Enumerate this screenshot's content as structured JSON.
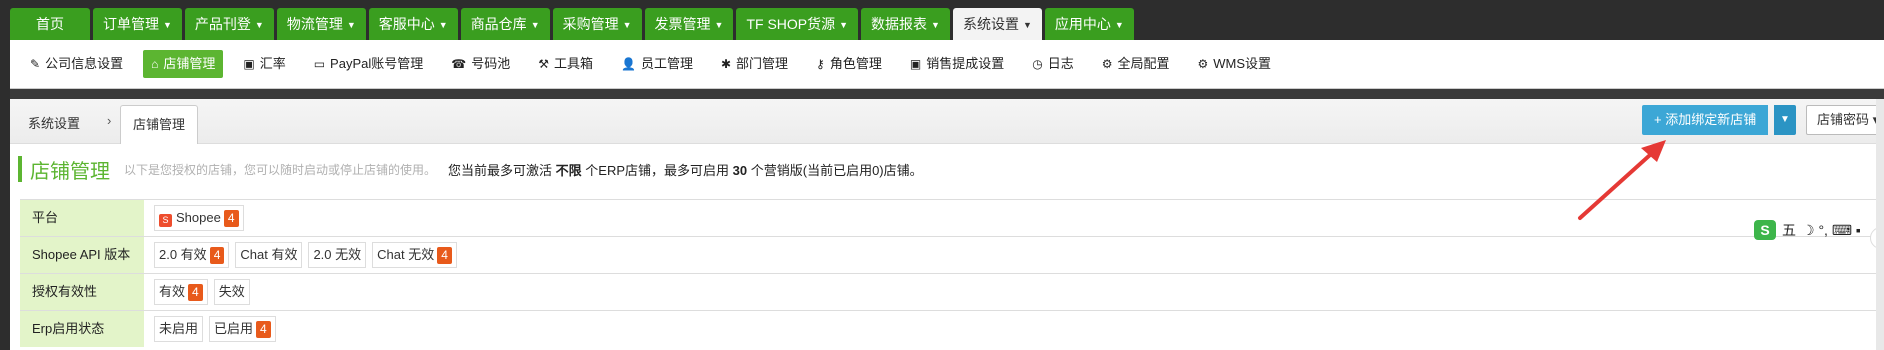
{
  "topnav": [
    {
      "label": "首页",
      "caret": false,
      "active": false
    },
    {
      "label": "订单管理",
      "caret": true,
      "active": false
    },
    {
      "label": "产品刊登",
      "caret": true,
      "active": false
    },
    {
      "label": "物流管理",
      "caret": true,
      "active": false
    },
    {
      "label": "客服中心",
      "caret": true,
      "active": false
    },
    {
      "label": "商品仓库",
      "caret": true,
      "active": false
    },
    {
      "label": "采购管理",
      "caret": true,
      "active": false
    },
    {
      "label": "发票管理",
      "caret": true,
      "active": false
    },
    {
      "label": "TF SHOP货源",
      "caret": true,
      "active": false
    },
    {
      "label": "数据报表",
      "caret": true,
      "active": false
    },
    {
      "label": "系统设置",
      "caret": true,
      "active": true
    },
    {
      "label": "应用中心",
      "caret": true,
      "active": false
    }
  ],
  "subnav": [
    {
      "label": "公司信息设置",
      "icon": "✎",
      "icon_name": "edit-icon",
      "active": false
    },
    {
      "label": "店铺管理",
      "icon": "⌂",
      "icon_name": "home-icon",
      "active": true
    },
    {
      "label": "汇率",
      "icon": "▣",
      "icon_name": "money-icon",
      "active": false
    },
    {
      "label": "PayPal账号管理",
      "icon": "▭",
      "icon_name": "card-icon",
      "active": false
    },
    {
      "label": "号码池",
      "icon": "☎",
      "icon_name": "inbox-icon",
      "active": false
    },
    {
      "label": "工具箱",
      "icon": "⚒",
      "icon_name": "wrench-icon",
      "active": false
    },
    {
      "label": "员工管理",
      "icon": "👤",
      "icon_name": "user-icon",
      "active": false
    },
    {
      "label": "部门管理",
      "icon": "✱",
      "icon_name": "asterisk-icon",
      "active": false
    },
    {
      "label": "角色管理",
      "icon": "⚷",
      "icon_name": "key-icon",
      "active": false
    },
    {
      "label": "销售提成设置",
      "icon": "▣",
      "icon_name": "money-icon",
      "active": false
    },
    {
      "label": "日志",
      "icon": "◷",
      "icon_name": "clock-icon",
      "active": false
    },
    {
      "label": "全局配置",
      "icon": "⚙",
      "icon_name": "gear-icon",
      "active": false
    },
    {
      "label": "WMS设置",
      "icon": "⚙",
      "icon_name": "gear-icon",
      "active": false
    }
  ],
  "breadcrumb": {
    "home": "系统设置",
    "sep": "›",
    "current": "店铺管理"
  },
  "actions": {
    "add_label": "+ 添加绑定新店铺",
    "pwd_label": "店铺密码 ▾"
  },
  "page": {
    "title": "店铺管理",
    "desc": "以下是您授权的店铺，您可以随时启动或停止店铺的使用。",
    "info_prefix": "您当前最多可激活",
    "info_unlimited": "不限",
    "info_mid": "个ERP店铺，最多可启用",
    "info_count": "30",
    "info_suffix": "个营销版(当前已启用0)店铺。"
  },
  "filters": [
    {
      "label": "平台",
      "chips": [
        {
          "text": "Shopee",
          "badge": "4",
          "icon": true
        }
      ]
    },
    {
      "label": "Shopee API 版本",
      "chips": [
        {
          "text": "2.0 有效",
          "badge": "4"
        },
        {
          "text": "Chat 有效",
          "badge": ""
        },
        {
          "text": "2.0 无效",
          "badge": ""
        },
        {
          "text": "Chat 无效",
          "badge": "4"
        }
      ]
    },
    {
      "label": "授权有效性",
      "chips": [
        {
          "text": "有效",
          "badge": "4"
        },
        {
          "text": "失效",
          "badge": ""
        }
      ]
    },
    {
      "label": "Erp启用状态",
      "chips": [
        {
          "text": "未启用",
          "badge": ""
        },
        {
          "text": "已启用",
          "badge": "4"
        }
      ]
    }
  ],
  "ime": {
    "s": "S",
    "mode": "五",
    "icons": "☽ °, ⌨ ▪"
  },
  "ybadge": "y",
  "colors": {
    "nav_green": "#3a9e1f",
    "accent_green": "#5cb531",
    "btn_blue": "#3ca7d6",
    "badge_orange": "#e85a1b",
    "arrow_red": "#e53935"
  }
}
